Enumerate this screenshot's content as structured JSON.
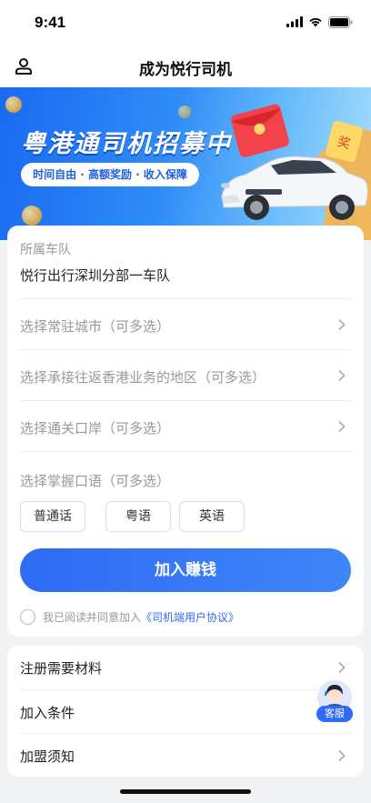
{
  "status": {
    "time": "9:41"
  },
  "nav": {
    "title": "成为悦行司机"
  },
  "banner": {
    "title": "粤港通司机招募中",
    "subtitle": "时间自由 · 高额奖励 · 收入保障",
    "badge": "奖"
  },
  "form": {
    "fleet_label": "所属车队",
    "fleet_value": "悦行出行深圳分部一车队",
    "rows": [
      {
        "label": "选择常驻城市（可多选）"
      },
      {
        "label": "选择承接往返香港业务的地区（可多选）"
      },
      {
        "label": "选择通关口岸（可多选）"
      }
    ],
    "language_label": "选择掌握口语（可多选）",
    "languages": [
      "普通话",
      "粤语",
      "英语"
    ],
    "join_button": "加入赚钱",
    "agreement_text": "我已阅读并同意加入",
    "agreement_link": "《司机端用户协议》"
  },
  "info": {
    "items": [
      {
        "label": "注册需要材料"
      },
      {
        "label": "加入条件"
      },
      {
        "label": "加盟须知"
      }
    ]
  },
  "service": {
    "label": "客服"
  },
  "colors": {
    "accent": "#2f6bf5",
    "banner_start": "#1a6af2",
    "banner_end": "#a9ddfd"
  }
}
